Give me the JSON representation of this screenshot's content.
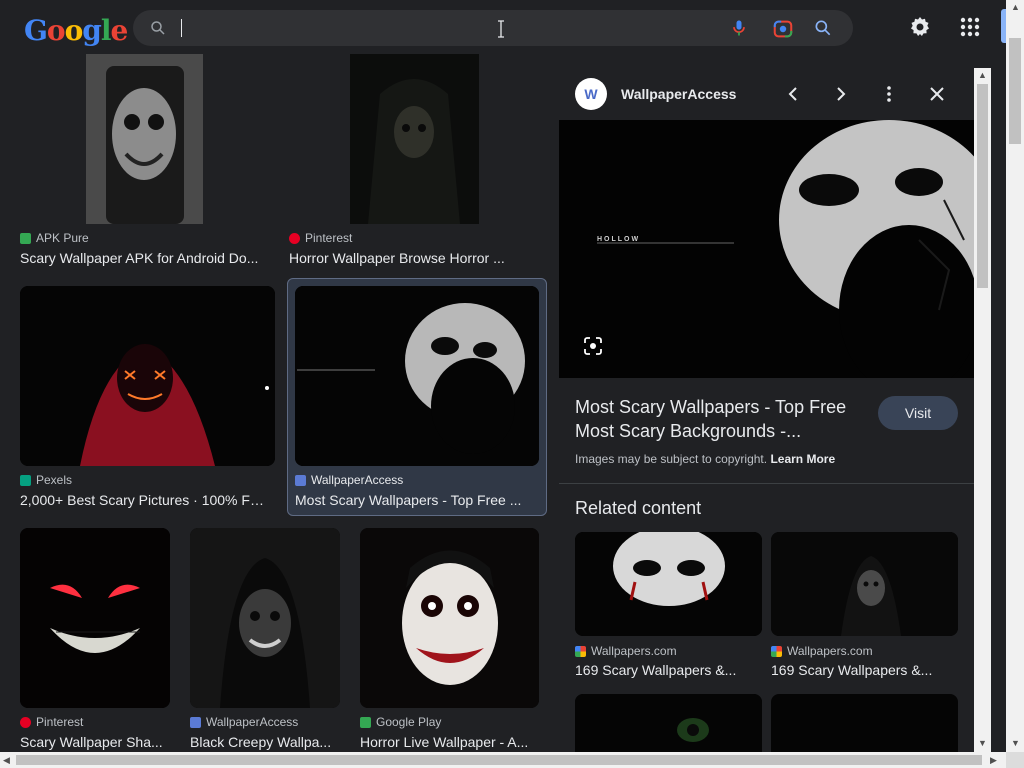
{
  "header": {
    "logo_letters": [
      {
        "ch": "G",
        "color": "#4285f4"
      },
      {
        "ch": "o",
        "color": "#ea4335"
      },
      {
        "ch": "o",
        "color": "#fbbc05"
      },
      {
        "ch": "g",
        "color": "#4285f4"
      },
      {
        "ch": "l",
        "color": "#34a853"
      },
      {
        "ch": "e",
        "color": "#ea4335"
      }
    ],
    "search_value": "",
    "icons": [
      "search-icon",
      "mic-icon",
      "lens-icon",
      "search-button-icon",
      "gear-icon",
      "apps-icon"
    ]
  },
  "results": [
    {
      "source": "APK Pure",
      "title": "Scary Wallpaper APK for Android Do...",
      "favicon_color": "#34a853"
    },
    {
      "source": "Pinterest",
      "title": "Horror Wallpaper Browse Horror ...",
      "favicon_color": "#e60023"
    },
    {
      "source": "Pexels",
      "title": "2,000+ Best Scary Pictures · 100% Fr...",
      "favicon_color": "#05a081"
    },
    {
      "source": "WallpaperAccess",
      "title": "Most Scary Wallpapers - Top Free ...",
      "favicon_color": "#5b7bd5",
      "selected": true
    },
    {
      "source": "Pinterest",
      "title": "Scary Wallpaper Sha...",
      "favicon_color": "#e60023"
    },
    {
      "source": "WallpaperAccess",
      "title": "Black Creepy Wallpa...",
      "favicon_color": "#5b7bd5"
    },
    {
      "source": "Google Play",
      "title": "Horror Live Wallpaper - A...",
      "favicon_color": "#34a853"
    }
  ],
  "panel": {
    "site_name": "WallpaperAccess",
    "image_caption_text": "HOLLOW",
    "title": "Most Scary Wallpapers - Top Free Most Scary Backgrounds -...",
    "visit_label": "Visit",
    "copyright_text": "Images may be subject to copyright.",
    "learn_more": "Learn More",
    "related_heading": "Related content",
    "related": [
      {
        "source": "Wallpapers.com",
        "title": "169 Scary Wallpapers &..."
      },
      {
        "source": "Wallpapers.com",
        "title": "169 Scary Wallpapers &..."
      }
    ]
  },
  "colors": {
    "background": "#202124",
    "search_box": "#303134",
    "accent_blue": "#8ab4f8",
    "visit_button": "#394457"
  }
}
